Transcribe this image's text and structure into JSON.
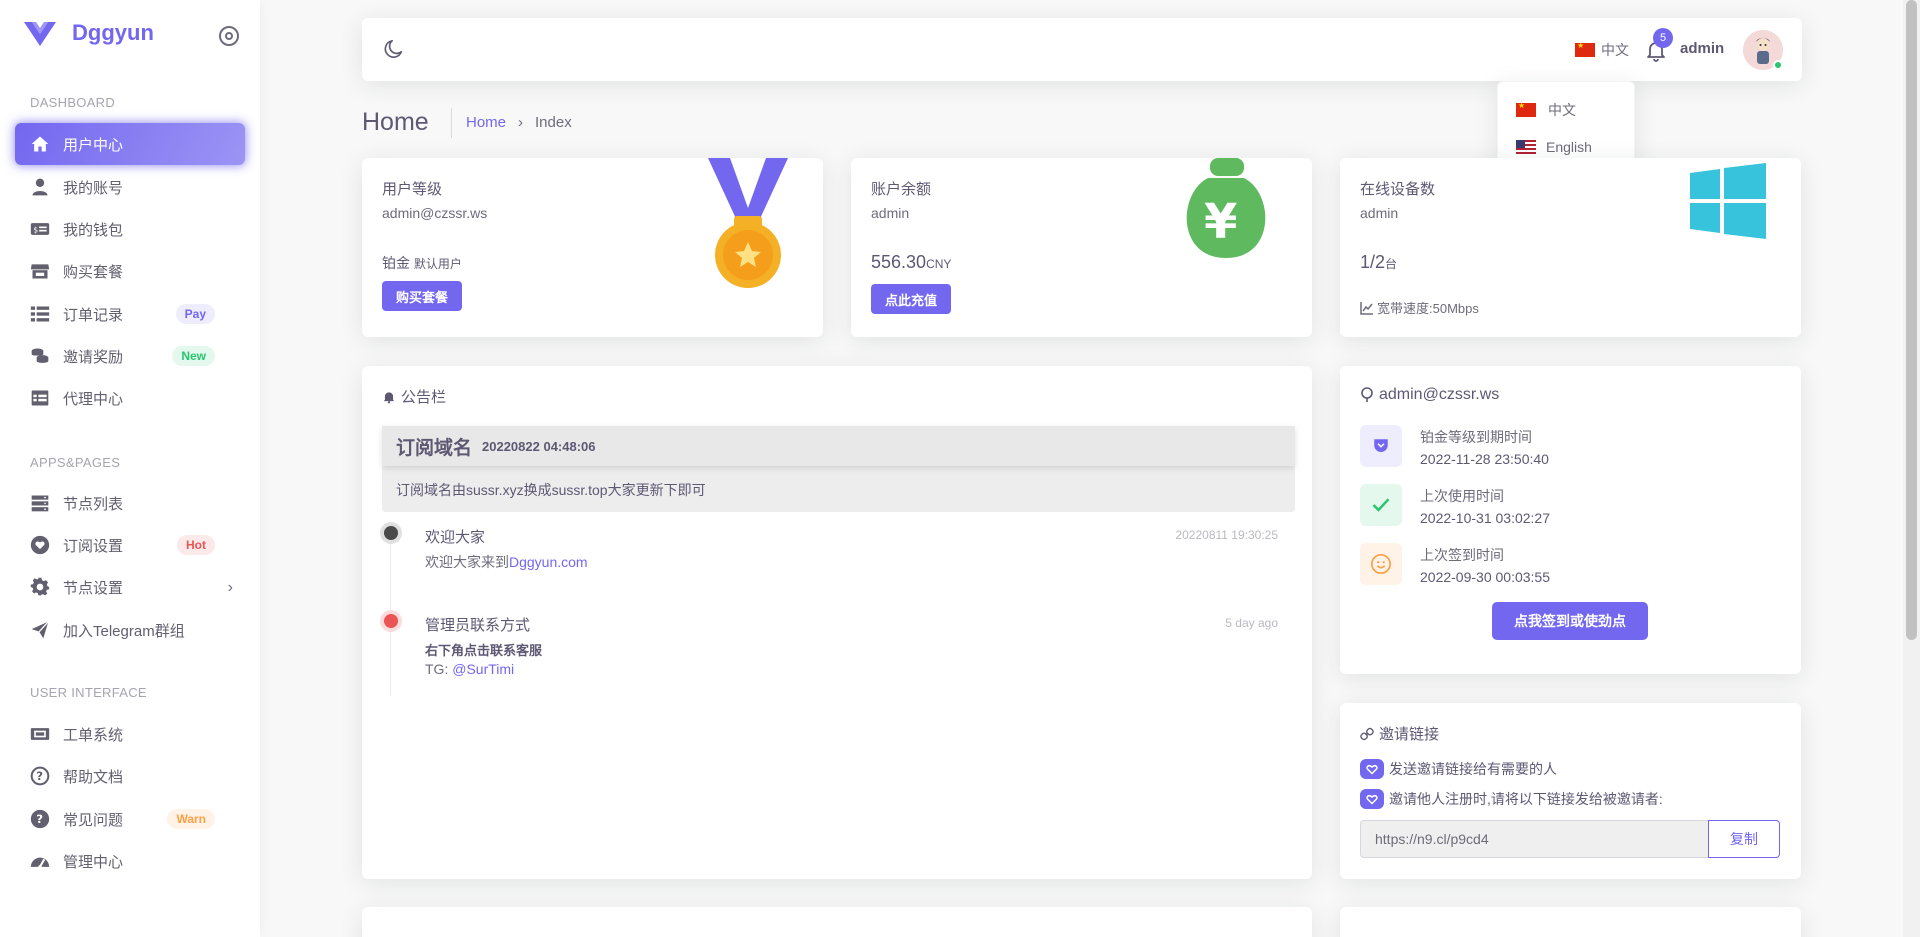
{
  "brand": {
    "name": "Dggyun"
  },
  "sidebar": {
    "sections": [
      "DASHBOARD",
      "APPS&PAGES",
      "USER INTERFACE"
    ],
    "items": [
      {
        "label": "用户中心",
        "icon": "home-icon"
      },
      {
        "label": "我的账号",
        "icon": "user-icon"
      },
      {
        "label": "我的钱包",
        "icon": "wallet-icon"
      },
      {
        "label": "购买套餐",
        "icon": "store-icon"
      },
      {
        "label": "订单记录",
        "icon": "list-icon",
        "badge": "Pay"
      },
      {
        "label": "邀请奖励",
        "icon": "coins-icon",
        "badge": "New"
      },
      {
        "label": "代理中心",
        "icon": "table-icon"
      },
      {
        "label": "节点列表",
        "icon": "server-icon"
      },
      {
        "label": "订阅设置",
        "icon": "heart-icon",
        "badge": "Hot"
      },
      {
        "label": "节点设置",
        "icon": "gear-icon"
      },
      {
        "label": "加入Telegram群组",
        "icon": "send-icon"
      },
      {
        "label": "工单系统",
        "icon": "ticket-icon"
      },
      {
        "label": "帮助文档",
        "icon": "help-icon"
      },
      {
        "label": "常见问题",
        "icon": "question-icon",
        "badge": "Warn"
      },
      {
        "label": "管理中心",
        "icon": "gauge-icon"
      }
    ]
  },
  "navbar": {
    "language": "中文",
    "notification_count": "5",
    "username": "admin",
    "lang_options": [
      "中文",
      "English"
    ]
  },
  "header": {
    "title": "Home",
    "breadcrumb": [
      "Home",
      "Index"
    ],
    "separator": "›"
  },
  "stats": {
    "level": {
      "label": "用户等级",
      "email": "admin@czssr.ws",
      "level_name": "铂金",
      "group": "默认用户",
      "button": "购买套餐"
    },
    "balance": {
      "label": "账户余额",
      "user": "admin",
      "amount": "556.30",
      "currency": "CNY",
      "button": "点此充值"
    },
    "devices": {
      "label": "在线设备数",
      "user": "admin",
      "count": "1/2",
      "unit": "台",
      "bandwidth": "宽带速度:50Mbps"
    }
  },
  "notice": {
    "title": "公告栏",
    "pinned": {
      "heading": "订阅域名",
      "time": "20220822 04:48:06",
      "body": "订阅域名由sussr.xyz换成sussr.top大家更新下即可"
    },
    "timeline": [
      {
        "title": "欢迎大家",
        "time": "20220811 19:30:25",
        "text_prefix": "欢迎大家来到",
        "link": "Dggyun.com",
        "color": "#4b4b4b"
      },
      {
        "title": "管理员联系方式",
        "time": "5 day ago",
        "bold": "右下角点击联系客服",
        "text_prefix": "TG: ",
        "link": "@SurTimi",
        "color": "#ea5455"
      }
    ]
  },
  "account": {
    "email": "admin@czssr.ws",
    "rows": [
      {
        "label": "铂金等级到期时间",
        "value": "2022-11-28 23:50:40",
        "icon": "pocket-icon",
        "color": "#7367f0"
      },
      {
        "label": "上次使用时间",
        "value": "2022-10-31 03:02:27",
        "icon": "check-icon",
        "color": "#28c76f"
      },
      {
        "label": "上次签到时间",
        "value": "2022-09-30 00:03:55",
        "icon": "smile-icon",
        "color": "#ff9f43"
      }
    ],
    "checkin_button": "点我签到或使劲点"
  },
  "invite": {
    "title": "邀请链接",
    "line1": "发送邀请链接给有需要的人",
    "line2": "邀请他人注册时,请将以下链接发给被邀请者:",
    "link": "https://n9.cl/p9cd4",
    "copy": "复制"
  },
  "colors": {
    "primary": "#7367f0",
    "success": "#28c76f",
    "danger": "#ea5455",
    "warning": "#ff9f43",
    "info": "#38c3dc"
  }
}
